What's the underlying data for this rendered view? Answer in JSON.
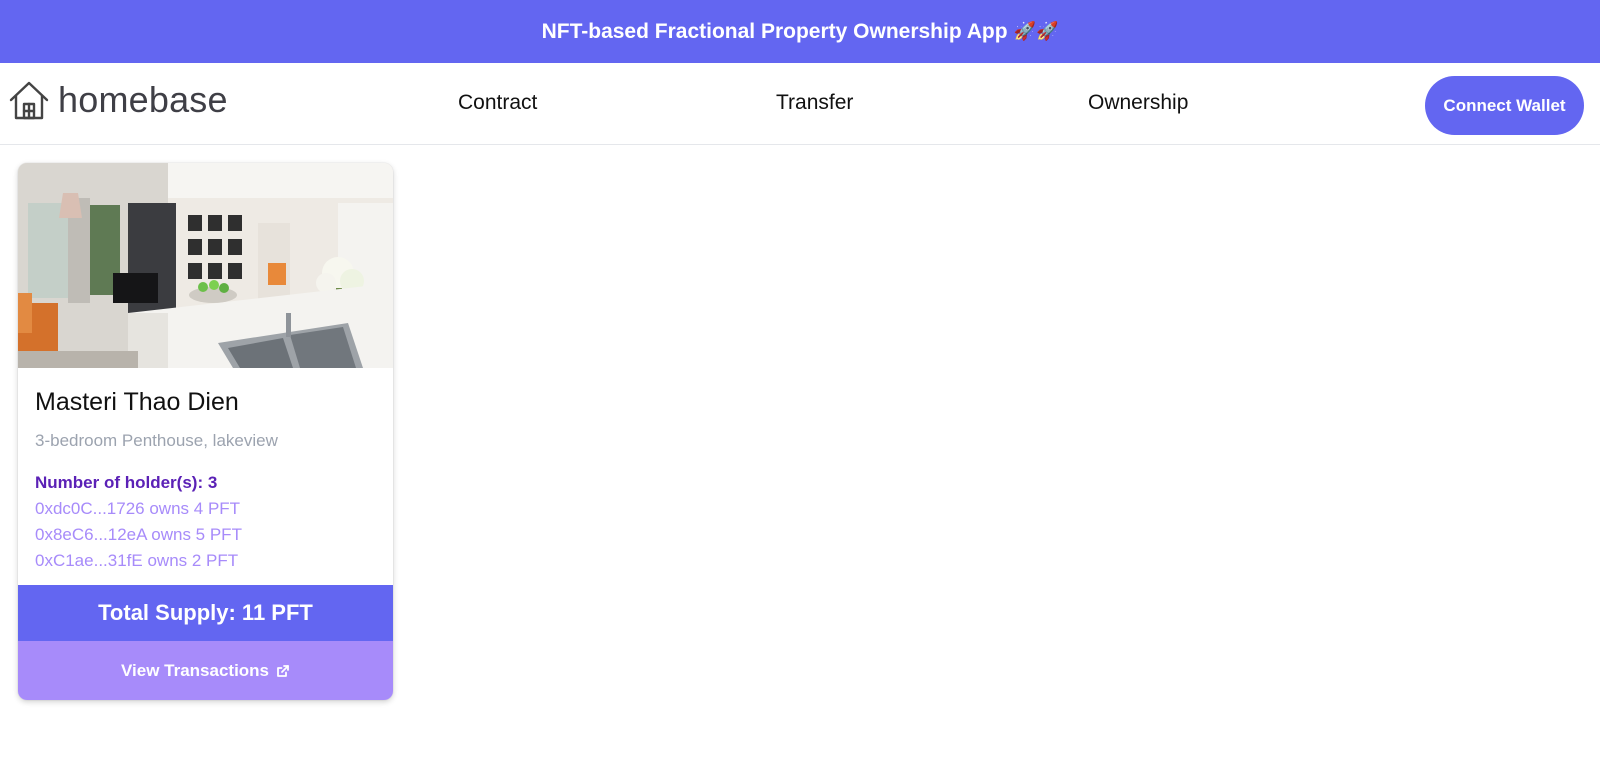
{
  "banner": {
    "title": "NFT-based Fractional Property Ownership App",
    "emoji": "🚀🚀"
  },
  "header": {
    "brand": "homebase",
    "logo_icon": "house-icon",
    "nav": [
      {
        "label": "Contract"
      },
      {
        "label": "Transfer"
      },
      {
        "label": "Ownership"
      }
    ],
    "connect_label": "Connect Wallet"
  },
  "property": {
    "name": "Masteri Thao Dien",
    "description": "3-bedroom Penthouse, lakeview",
    "holders_label": "Number of holder(s): 3",
    "holders": [
      {
        "text": "0xdc0C...1726 owns 4 PFT"
      },
      {
        "text": "0x8eC6...12eA owns 5 PFT"
      },
      {
        "text": "0xC1ae...31fE owns 2 PFT"
      }
    ],
    "total_supply": "Total Supply: 11 PFT",
    "view_transactions": "View Transactions",
    "external_icon": "external-link-icon"
  },
  "colors": {
    "primary": "#6366f1",
    "accent": "#a78bfa",
    "holder_count": "#5b21b6",
    "muted": "#9ca3af"
  }
}
